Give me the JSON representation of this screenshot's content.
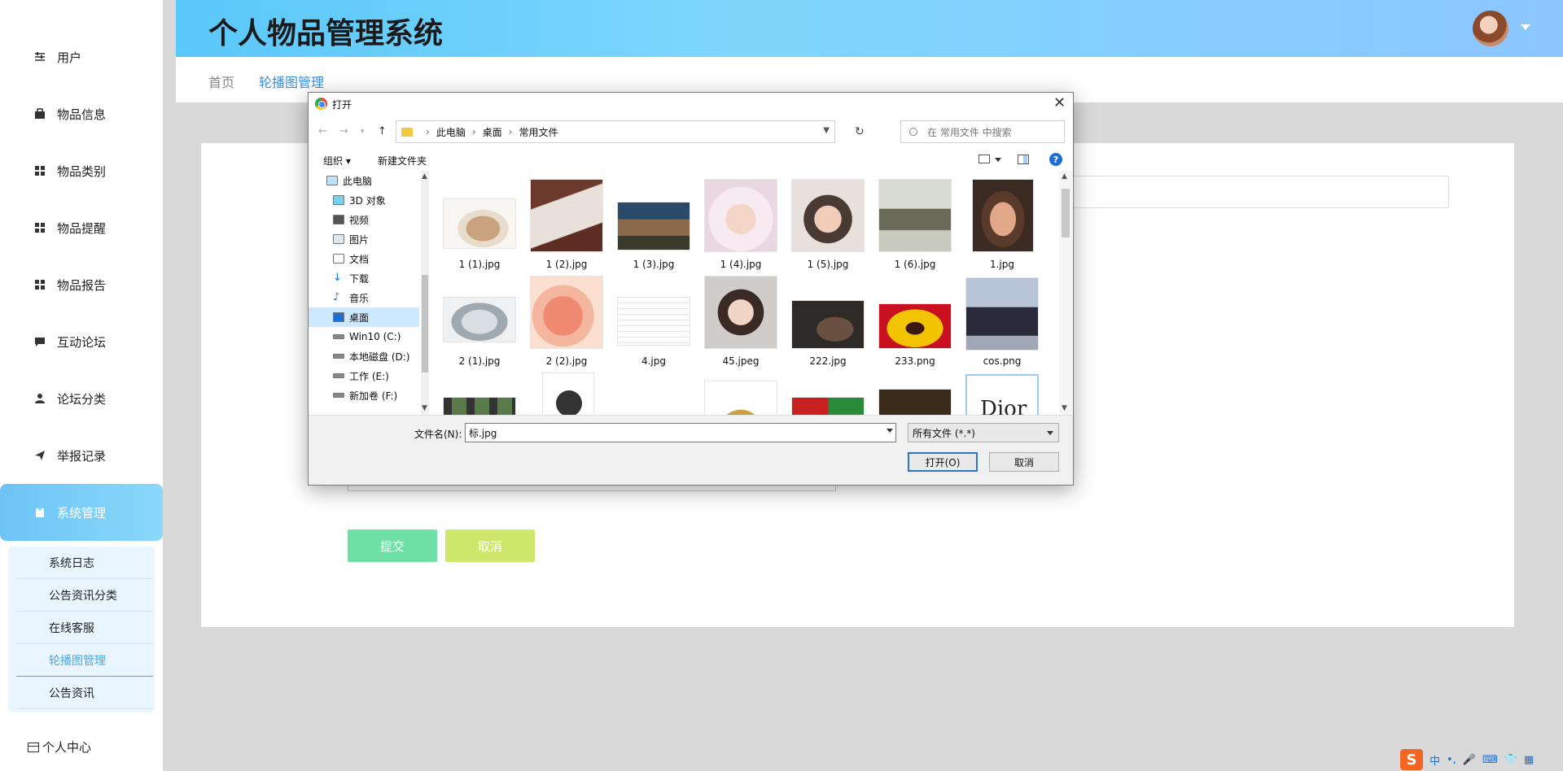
{
  "app": {
    "title": "个人物品管理系统"
  },
  "sidebar": {
    "items": [
      {
        "label": "用户",
        "icon": "sliders-icon"
      },
      {
        "label": "物品信息",
        "icon": "briefcase-icon"
      },
      {
        "label": "物品类别",
        "icon": "grid-icon"
      },
      {
        "label": "物品提醒",
        "icon": "grid-icon"
      },
      {
        "label": "物品报告",
        "icon": "grid-icon"
      },
      {
        "label": "互动论坛",
        "icon": "chat-icon"
      },
      {
        "label": "论坛分类",
        "icon": "person-icon"
      },
      {
        "label": "举报记录",
        "icon": "send-icon"
      },
      {
        "label": "系统管理",
        "icon": "clipboard-icon"
      }
    ],
    "sub_items": [
      "系统日志",
      "公告资讯分类",
      "在线客服",
      "轮播图管理",
      "公告资讯"
    ],
    "personal": "个人中心"
  },
  "breadcrumb": {
    "home": "首页",
    "current": "轮播图管理"
  },
  "form": {
    "submit": "提交",
    "cancel": "取消"
  },
  "dialog": {
    "title": "打开",
    "path": [
      "此电脑",
      "桌面",
      "常用文件"
    ],
    "search_placeholder": "在 常用文件 中搜索",
    "organize": "组织 ▾",
    "new_folder": "新建文件夹",
    "nav_tree": [
      "此电脑",
      "3D 对象",
      "视频",
      "图片",
      "文档",
      "下载",
      "音乐",
      "桌面",
      "Win10 (C:)",
      "本地磁盘 (D:)",
      "工作 (E:)",
      "新加卷 (F:)"
    ],
    "selected_tree": "桌面",
    "files": [
      "1 (1).jpg",
      "1 (2).jpg",
      "1 (3).jpg",
      "1 (4).jpg",
      "1 (5).jpg",
      "1 (6).jpg",
      "1.jpg",
      "2 (1).jpg",
      "2 (2).jpg",
      "4.jpg",
      "45.jpeg",
      "222.jpg",
      "233.png",
      "cos.png"
    ],
    "filename_label": "文件名(N):",
    "filename_value": "标.jpg",
    "filetype": "所有文件 (*.*)",
    "open": "打开(O)",
    "cancel": "取消"
  },
  "tray": {
    "ime": "S",
    "lang": "中"
  }
}
